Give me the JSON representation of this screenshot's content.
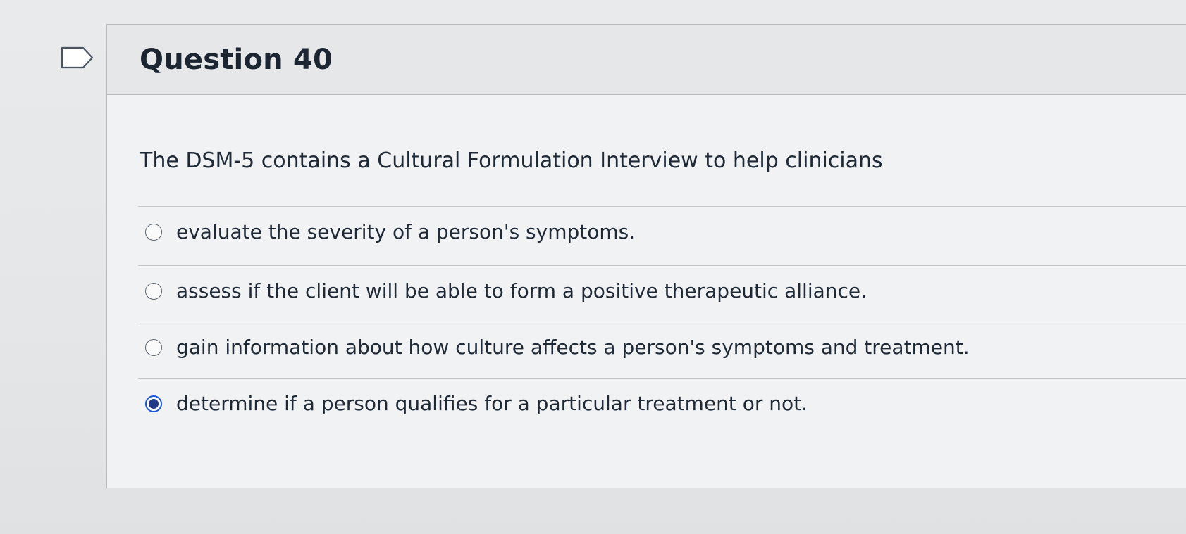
{
  "question": {
    "title": "Question 40",
    "prompt": "The DSM-5 contains a Cultural Formulation Interview to help clinicians",
    "options": [
      {
        "label": "evaluate the severity of a person's symptoms.",
        "selected": false
      },
      {
        "label": "assess if the client will be able to form a positive therapeutic alliance.",
        "selected": false
      },
      {
        "label": "gain information about how culture affects a person's symptoms and treatment.",
        "selected": false
      },
      {
        "label": "determine if a person qualifies for a particular treatment or not.",
        "selected": true
      }
    ]
  },
  "colors": {
    "radio_selected": "#1a56d6",
    "radio_selected_dot": "#1f3a8a",
    "text": "#1f2a36",
    "border": "#b9bdc2"
  },
  "icons": {
    "flag": "flag-icon"
  }
}
